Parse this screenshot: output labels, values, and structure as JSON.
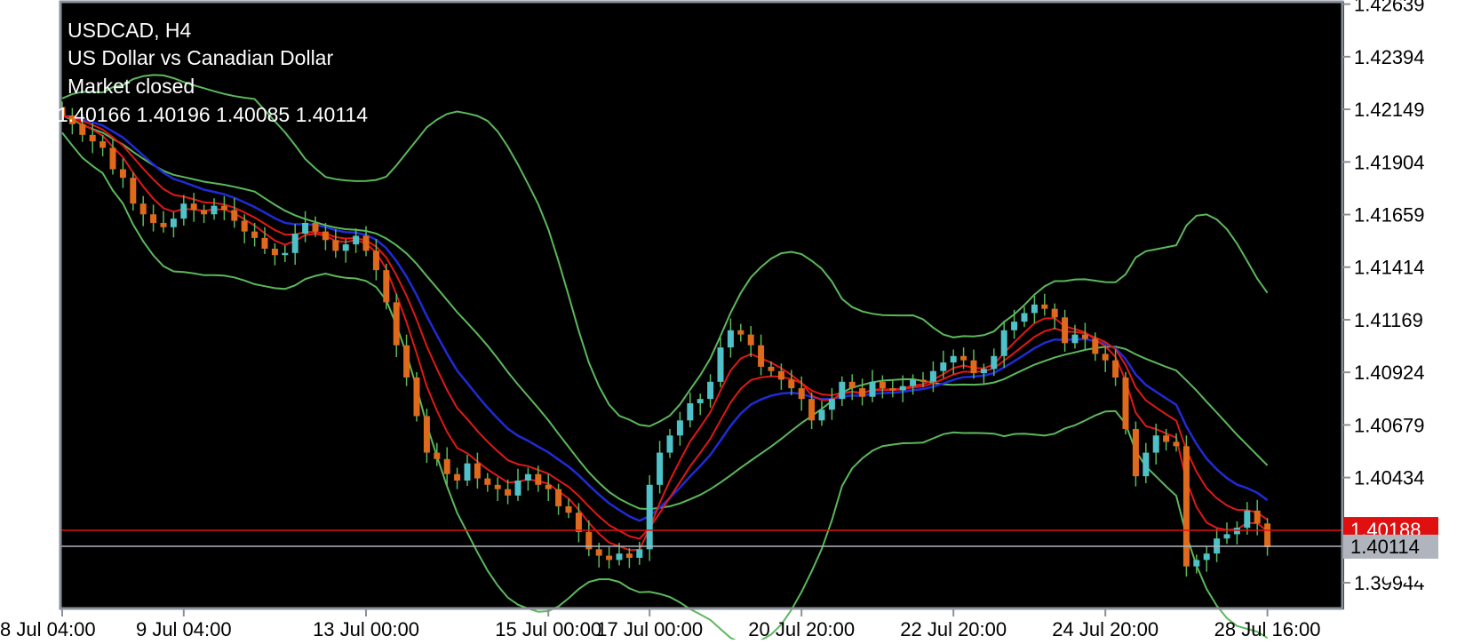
{
  "header": {
    "symbol_line": "USDCAD, H4",
    "description": "US Dollar vs Canadian Dollar",
    "status": "Market closed",
    "ohlc": "1.40166 1.40196 1.40085 1.40114"
  },
  "price_labels": {
    "bid": "1.40114",
    "ask": "1.40188"
  },
  "more_icon": "ellipsis-icon",
  "colors": {
    "background": "#000000",
    "frame": "#8a8f9a",
    "bull_candle": "#4fc1c8",
    "bear_candle": "#e06a1c",
    "wick": "#5cb85c",
    "bollinger": "#5cb85c",
    "ma_blue": "#1f2bd6",
    "ma_red": "#e01818",
    "ask_line": "#e01010",
    "bid_line": "#b0b4bc",
    "text": "#ffffff"
  },
  "chart_data": {
    "type": "candlestick",
    "symbol": "USDCAD",
    "timeframe": "H4",
    "y_ticks": [
      "1.42639",
      "1.42394",
      "1.42149",
      "1.41904",
      "1.41659",
      "1.41414",
      "1.41169",
      "1.40924",
      "1.40679",
      "1.40434",
      "1.39944"
    ],
    "ylim": [
      1.3982,
      1.4265
    ],
    "x_ticks": [
      {
        "label": "8 Jul 04:00",
        "bar": 0
      },
      {
        "label": "9 Jul 04:00",
        "bar": 12
      },
      {
        "label": "13 Jul 00:00",
        "bar": 30
      },
      {
        "label": "15 Jul 00:00",
        "bar": 48
      },
      {
        "label": "17 Jul 00:00",
        "bar": 58
      },
      {
        "label": "20 Jul 20:00",
        "bar": 73
      },
      {
        "label": "22 Jul 20:00",
        "bar": 88
      },
      {
        "label": "24 Jul 20:00",
        "bar": 103
      },
      {
        "label": "28 Jul 16:00",
        "bar": 119
      }
    ],
    "close": [
      1.4212,
      1.4208,
      1.4203,
      1.42,
      1.4197,
      1.4187,
      1.4183,
      1.4171,
      1.4166,
      1.4162,
      1.416,
      1.4164,
      1.4171,
      1.4168,
      1.4166,
      1.417,
      1.4168,
      1.4163,
      1.4158,
      1.4155,
      1.415,
      1.4147,
      1.4148,
      1.4157,
      1.4162,
      1.4158,
      1.4154,
      1.4149,
      1.4152,
      1.4156,
      1.4149,
      1.414,
      1.4125,
      1.4105,
      1.409,
      1.4072,
      1.4055,
      1.4052,
      1.4045,
      1.4042,
      1.405,
      1.4043,
      1.404,
      1.4038,
      1.4035,
      1.4042,
      1.4045,
      1.404,
      1.4038,
      1.403,
      1.4027,
      1.4018,
      1.401,
      1.4007,
      1.4005,
      1.4008,
      1.4006,
      1.401,
      1.404,
      1.4055,
      1.4063,
      1.407,
      1.4078,
      1.408,
      1.4088,
      1.4104,
      1.4112,
      1.411,
      1.4105,
      1.4095,
      1.4093,
      1.4089,
      1.4085,
      1.408,
      1.407,
      1.4075,
      1.408,
      1.4088,
      1.4085,
      1.4081,
      1.4088,
      1.4085,
      1.4084,
      1.4086,
      1.4089,
      1.4088,
      1.4093,
      1.4097,
      1.41,
      1.4098,
      1.4092,
      1.4094,
      1.41,
      1.4112,
      1.4116,
      1.412,
      1.4124,
      1.4122,
      1.4118,
      1.4106,
      1.411,
      1.4108,
      1.4101,
      1.4098,
      1.409,
      1.4066,
      1.4044,
      1.4055,
      1.4063,
      1.406,
      1.4058,
      1.4002,
      1.4005,
      1.4008,
      1.4015,
      1.4017,
      1.402,
      1.4028,
      1.4022,
      1.4011
    ]
  }
}
